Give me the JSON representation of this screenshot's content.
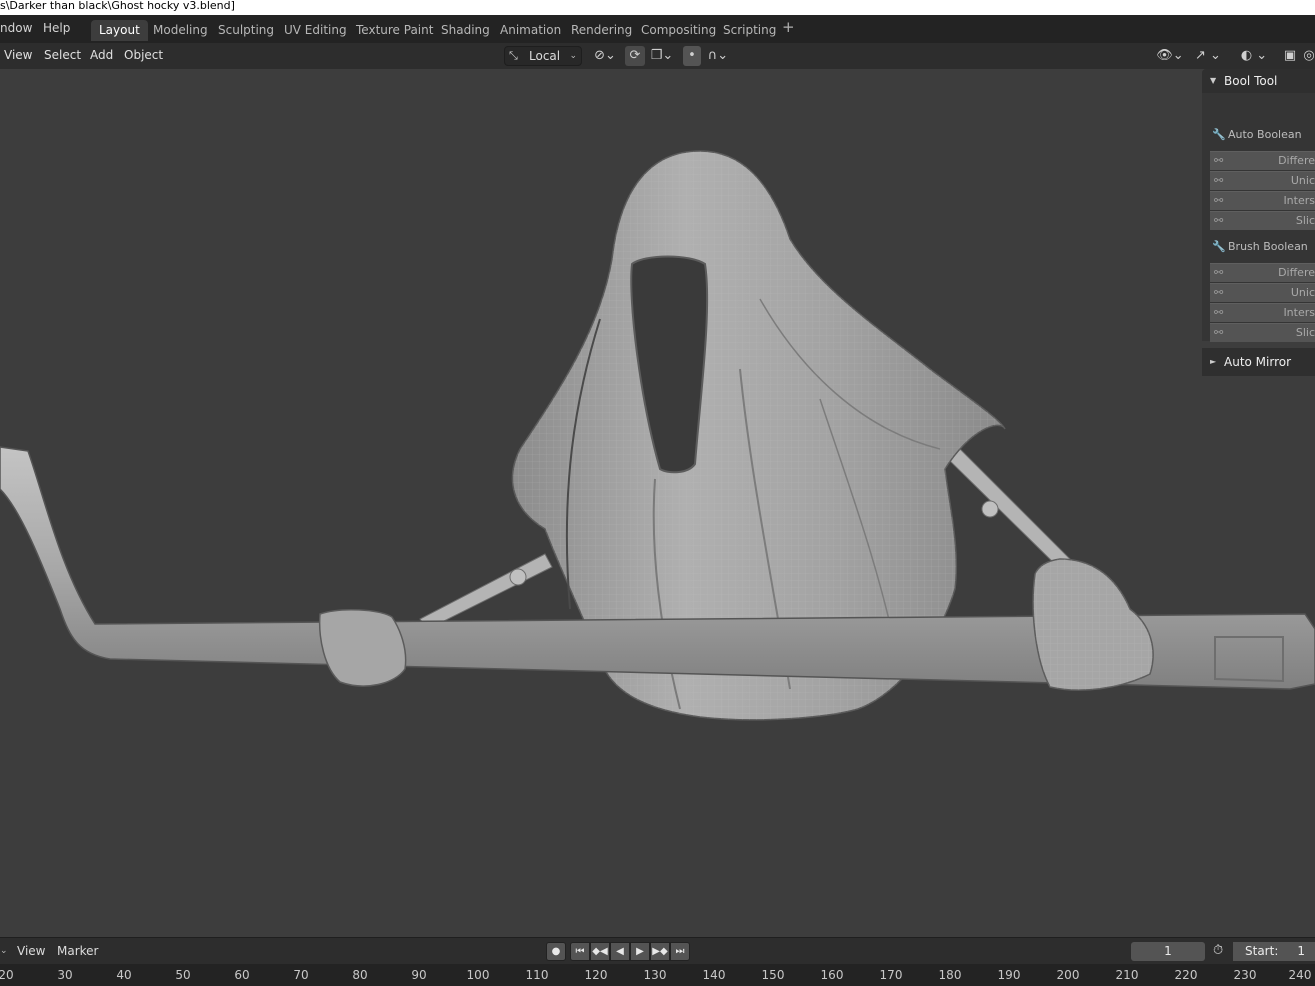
{
  "window": {
    "title_fragment": "s\\Darker than black\\Ghost hocky v3.blend]"
  },
  "topbar": {
    "menus": [
      "ndow",
      "Help"
    ],
    "workspaces": [
      "Layout",
      "Modeling",
      "Sculpting",
      "UV Editing",
      "Texture Paint",
      "Shading",
      "Animation",
      "Rendering",
      "Compositing",
      "Scripting"
    ],
    "active_workspace": "Layout",
    "add_workspace": "+"
  },
  "viewport_header": {
    "menus": [
      "View",
      "Select",
      "Add",
      "Object"
    ],
    "transform_orientation": "Local",
    "icons": [
      "transform-orientation-icon",
      "pivot-link-icon",
      "snap-icon",
      "snap-target-icon",
      "proportional-edit-icon",
      "falloff-icon",
      "visibility-icon",
      "gizmo-icon",
      "overlay-icon",
      "xray-icon"
    ]
  },
  "sidebar_panel": {
    "bool_tool_title": "Bool Tool",
    "auto_boolean_label": "Auto Boolean",
    "auto_boolean_ops": [
      "Differe",
      "Unic",
      "Inters",
      "Slic"
    ],
    "brush_boolean_label": "Brush Boolean",
    "brush_boolean_ops": [
      "Differe",
      "Unic",
      "Inters",
      "Slic"
    ],
    "auto_mirror_title": "Auto Mirror"
  },
  "timeline": {
    "menus": [
      "View",
      "Marker"
    ],
    "current_frame": "1",
    "start_label": "Start:",
    "start_value": "1",
    "ruler_ticks": [
      "20",
      "30",
      "40",
      "50",
      "60",
      "70",
      "80",
      "90",
      "100",
      "110",
      "120",
      "130",
      "140",
      "150",
      "160",
      "170",
      "180",
      "190",
      "200",
      "210",
      "220",
      "230",
      "240"
    ]
  },
  "colors": {
    "viewport_bg": "#3d3d3d",
    "header_bg": "#2d2d2d",
    "topbar_bg": "#232323",
    "model_gray": "#a6a6a6"
  }
}
